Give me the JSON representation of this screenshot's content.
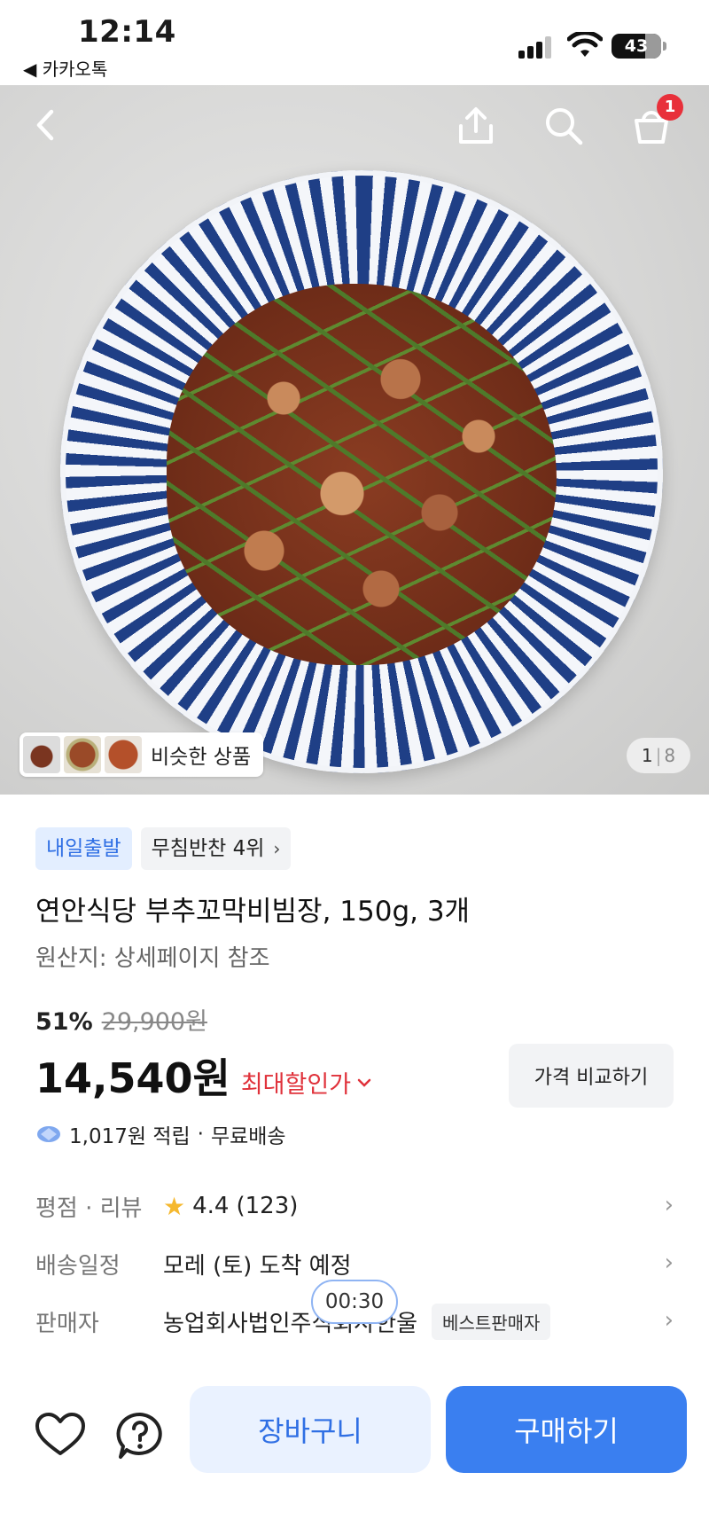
{
  "status_bar": {
    "time": "12:14",
    "back_app": "◀ 카카오톡",
    "battery": "43",
    "icons": [
      "signal-icon",
      "wifi-icon",
      "battery-icon"
    ]
  },
  "hero": {
    "cart_count": "1",
    "similar_label": "비슷한 상품",
    "image_index": "1",
    "image_separator": "|",
    "image_total": "8",
    "icons": [
      "back-arrow-icon",
      "share-icon",
      "search-icon",
      "shopping-bag-icon"
    ]
  },
  "tags": {
    "shipping": "내일출발",
    "ranking": "무침반찬 4위"
  },
  "product": {
    "title": "연안식당 부추꼬막비빔장, 150g, 3개",
    "origin": "원산지: 상세페이지 참조"
  },
  "pricing": {
    "discount_rate": "51%",
    "original_price": "29,900원",
    "price": "14,540원",
    "max_discount_label": "최대할인가",
    "compare_label": "가격 비교하기",
    "points": "1,017원 적립",
    "separator": "·",
    "shipping_fee": "무료배송"
  },
  "info": {
    "rating_label": "평점 · 리뷰",
    "rating_value": "4.4",
    "review_count": "(123)",
    "delivery_label": "배송일정",
    "delivery_value": "모레 (토) 도착 예정",
    "seller_label": "판매자",
    "seller_name": "농업회사법인주식회사한울",
    "seller_badge": "베스트판매자"
  },
  "timer": "00:30",
  "bottom_bar": {
    "cart_label": "장바구니",
    "buy_label": "구매하기"
  },
  "colors": {
    "accent": "#3a7ff0",
    "discount_red": "#e0323b",
    "badge_red": "#e8303a",
    "star": "#f5b82e"
  }
}
